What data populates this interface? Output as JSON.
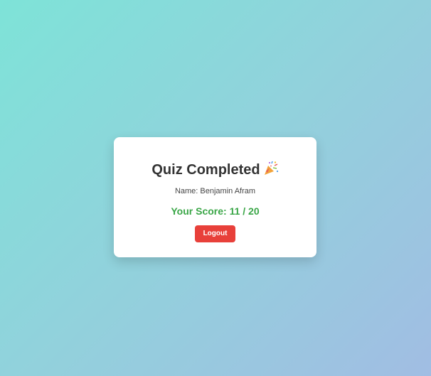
{
  "card": {
    "title": "Quiz Completed",
    "title_icon": "party-popper-icon",
    "name_line": "Name: Benjamin Afram",
    "score_line": "Your Score: 11 / 20",
    "logout_label": "Logout"
  },
  "colors": {
    "score": "#3aa647",
    "logout_button": "#e8403a",
    "background_start": "#7ee3d8",
    "background_end": "#a1bde3"
  }
}
